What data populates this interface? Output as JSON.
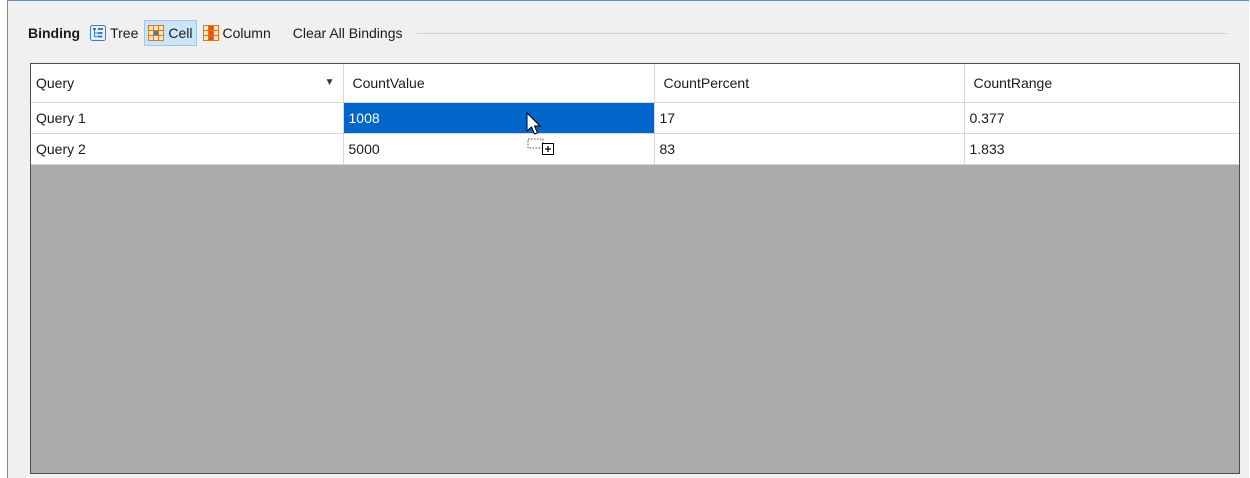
{
  "toolbar": {
    "title": "Binding",
    "tree_label": "Tree",
    "cell_label": "Cell",
    "column_label": "Column",
    "clear_label": "Clear All Bindings"
  },
  "grid": {
    "columns": [
      "Query",
      "CountValue",
      "CountPercent",
      "CountRange"
    ],
    "rows": [
      [
        "Query 1",
        "1008",
        "17",
        "0.377"
      ],
      [
        "Query 2",
        "5000",
        "83",
        "1.833"
      ]
    ],
    "selected_cell": {
      "row": 0,
      "col": 1
    }
  },
  "colors": {
    "selection": "#0066cc",
    "empty_area": "#ababab",
    "active_button": "#cce4f7"
  },
  "icons": {
    "tree": "tree-icon",
    "cell": "cell-grid-icon",
    "column": "column-grid-icon",
    "cursor": "drag-copy-cursor-icon"
  }
}
